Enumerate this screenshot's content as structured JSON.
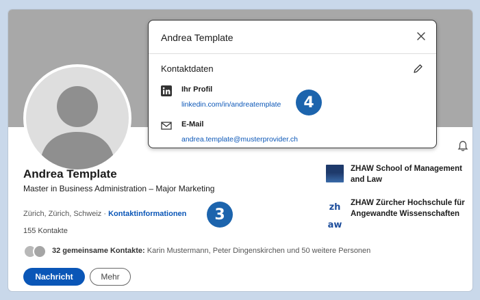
{
  "profile": {
    "name": "Andrea Template",
    "headline": "Master in Business Administration – Major Marketing",
    "location": "Zürich, Zürich, Schweiz ·",
    "contact_info_link": "Kontaktinformationen",
    "connections": "155 Kontakte",
    "mutual_count": "32 gemeinsame Kontakte:",
    "mutual_names": "Karin Mustermann, Peter Dingenskirchen und 50 weitere Personen"
  },
  "actions": {
    "message": "Nachricht",
    "more": "Mehr"
  },
  "education": [
    {
      "name": "ZHAW School of Management and Law",
      "logo": "zhaw-school-logo"
    },
    {
      "name": "ZHAW Zürcher Hochschule für Angewandte Wissenschaften",
      "logo": "zhaw-logo",
      "logo_text": "zh aw"
    }
  ],
  "modal": {
    "title": "Andrea Template",
    "section": "Kontaktdaten",
    "profile_label": "Ihr Profil",
    "profile_value": "linkedin.com/in/andreatemplate",
    "email_label": "E-Mail",
    "email_value": "andrea.template@musterprovider.ch"
  },
  "callouts": {
    "three": "3",
    "four": "4"
  },
  "icons": [
    "linkedin-icon",
    "mail-icon",
    "pencil-icon",
    "close-icon",
    "bell-icon",
    "avatar-placeholder-icon"
  ],
  "colors": {
    "accent": "#0a56b7",
    "callout": "#1c64ad",
    "banner": "#a8a8a8",
    "page_background": "#c9d8ea"
  }
}
